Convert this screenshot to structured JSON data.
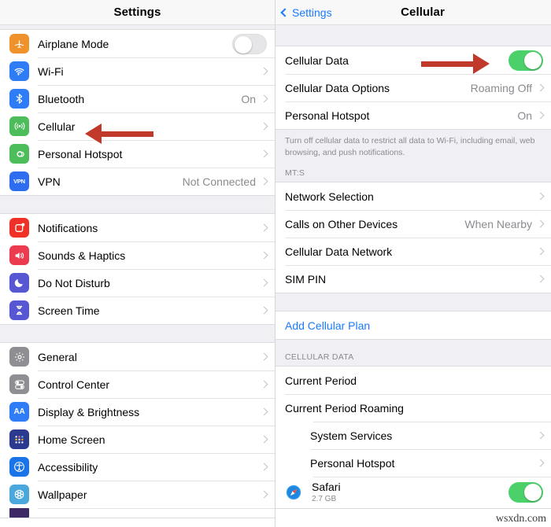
{
  "left_panel": {
    "nav": {
      "title": "Settings"
    },
    "groups": [
      {
        "rows": [
          {
            "label": "Airplane Mode",
            "icon": "airplane-icon",
            "icon_color": "#f0922b",
            "control": "toggle",
            "toggle_state": "off"
          },
          {
            "label": "Wi-Fi",
            "icon": "wifi-icon",
            "icon_color": "#2f7df6",
            "control": "chevron"
          },
          {
            "label": "Bluetooth",
            "icon": "bluetooth-icon",
            "icon_color": "#2f7df6",
            "value": "On",
            "control": "chevron"
          },
          {
            "label": "Cellular",
            "icon": "cellular-antenna-icon",
            "icon_color": "#4cbd5a",
            "control": "chevron"
          },
          {
            "label": "Personal Hotspot",
            "icon": "personal-hotspot-icon",
            "icon_color": "#4cbd5a",
            "control": "chevron"
          },
          {
            "label": "VPN",
            "icon": "vpn-icon",
            "icon_color": "#2f6df0",
            "value": "Not Connected",
            "control": "chevron"
          }
        ]
      },
      {
        "rows": [
          {
            "label": "Notifications",
            "icon": "notifications-icon",
            "icon_color": "#f03127",
            "control": "chevron"
          },
          {
            "label": "Sounds & Haptics",
            "icon": "sounds-haptics-icon",
            "icon_color": "#ec3b4e",
            "control": "chevron"
          },
          {
            "label": "Do Not Disturb",
            "icon": "do-not-disturb-moon-icon",
            "icon_color": "#5757d4",
            "control": "chevron"
          },
          {
            "label": "Screen Time",
            "icon": "screen-time-hourglass-icon",
            "icon_color": "#5757d4",
            "control": "chevron"
          }
        ]
      },
      {
        "rows": [
          {
            "label": "General",
            "icon": "gear-icon",
            "icon_color": "#8e8e93",
            "control": "chevron"
          },
          {
            "label": "Control Center",
            "icon": "control-center-icon",
            "icon_color": "#8e8e93",
            "control": "chevron"
          },
          {
            "label": "Display & Brightness",
            "icon": "display-brightness-icon",
            "icon_color": "#2f7df6",
            "control": "chevron"
          },
          {
            "label": "Home Screen",
            "icon": "home-screen-grid-icon",
            "icon_color": "#2b3a8f",
            "control": "chevron"
          },
          {
            "label": "Accessibility",
            "icon": "accessibility-icon",
            "icon_color": "#1a73e8",
            "control": "chevron"
          },
          {
            "label": "Wallpaper",
            "icon": "wallpaper-flower-icon",
            "icon_color": "#4aa8dc",
            "control": "chevron"
          }
        ]
      }
    ],
    "annotation_arrow": {
      "name": "red-arrow-pointing-to-cellular",
      "direction": "left"
    }
  },
  "right_panel": {
    "nav": {
      "back_label": "Settings",
      "title": "Cellular"
    },
    "group_main": {
      "rows": [
        {
          "label": "Cellular Data",
          "control": "toggle",
          "toggle_state": "on"
        },
        {
          "label": "Cellular Data Options",
          "value": "Roaming Off",
          "control": "chevron"
        },
        {
          "label": "Personal Hotspot",
          "value": "On",
          "control": "chevron"
        }
      ],
      "footer": "Turn off cellular data to restrict all data to Wi-Fi, including email, web browsing, and push notifications."
    },
    "group_carrier": {
      "header": "MT:S",
      "rows": [
        {
          "label": "Network Selection",
          "control": "chevron"
        },
        {
          "label": "Calls on Other Devices",
          "value": "When Nearby",
          "control": "chevron"
        },
        {
          "label": "Cellular Data Network",
          "control": "chevron"
        },
        {
          "label": "SIM PIN",
          "control": "chevron"
        }
      ]
    },
    "group_add_plan": {
      "rows": [
        {
          "label": "Add Cellular Plan",
          "style": "link"
        }
      ]
    },
    "group_usage": {
      "header": "CELLULAR DATA",
      "rows": [
        {
          "label": "Current Period",
          "control": "none"
        },
        {
          "label": "Current Period Roaming",
          "control": "none"
        },
        {
          "label": "System Services",
          "control": "chevron",
          "indent": true
        },
        {
          "label": "Personal Hotspot",
          "control": "chevron",
          "indent": true
        },
        {
          "label": "Safari",
          "sublabel": "2.7 GB",
          "icon": "safari-compass-icon",
          "control": "toggle",
          "toggle_state": "on"
        }
      ]
    },
    "annotation_arrow": {
      "name": "red-arrow-pointing-to-cellular-data-toggle",
      "direction": "right"
    }
  },
  "watermark": {
    "text": "wsxdn.com"
  },
  "colors": {
    "accent_blue": "#1a7aff",
    "toggle_on_green": "#4cd06a",
    "annotation_red": "#c0392b",
    "group_background": "#efeff4"
  }
}
